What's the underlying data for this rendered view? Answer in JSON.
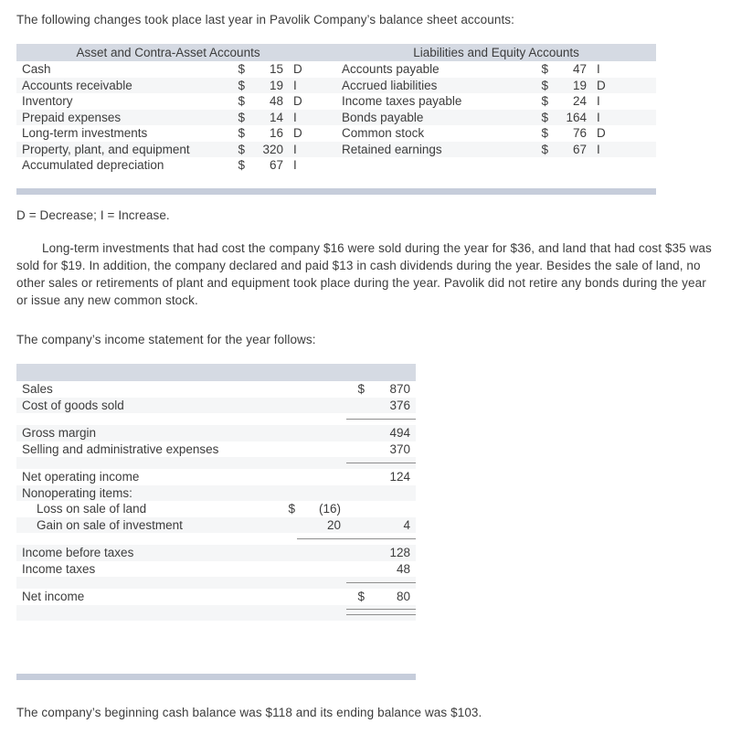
{
  "intro_text": "The following changes took place last year in Pavolik Company’s balance sheet accounts:",
  "legend_text": "D = Decrease; I = Increase.",
  "story_text": "Long-term investments that had cost the company $16 were sold during the year for $36, and land that had cost $35 was sold for $19. In addition, the company declared and paid $13 in cash dividends during the year. Besides the sale of land, no other sales or retirements of plant and equipment took place during the year. Pavolik did not retire any bonds during the year or issue any new common stock.",
  "income_intro_text": "The company’s income statement for the year follows:",
  "closing_text": "The company’s beginning cash balance was $118 and its ending balance was $103.",
  "balance_sheet": {
    "left_header": "Asset and Contra-Asset Accounts",
    "right_header": "Liabilities and Equity Accounts",
    "left_rows": [
      {
        "label": "Cash",
        "currency": "$",
        "amount": "15",
        "change": "D"
      },
      {
        "label": "Accounts receivable",
        "currency": "$",
        "amount": "19",
        "change": "I"
      },
      {
        "label": "Inventory",
        "currency": "$",
        "amount": "48",
        "change": "D"
      },
      {
        "label": "Prepaid expenses",
        "currency": "$",
        "amount": "14",
        "change": "I"
      },
      {
        "label": "Long-term investments",
        "currency": "$",
        "amount": "16",
        "change": "D"
      },
      {
        "label": "Property, plant, and equipment",
        "currency": "$",
        "amount": "320",
        "change": "I"
      },
      {
        "label": "Accumulated depreciation",
        "currency": "$",
        "amount": "67",
        "change": "I"
      }
    ],
    "right_rows": [
      {
        "label": "Accounts payable",
        "currency": "$",
        "amount": "47",
        "change": "I"
      },
      {
        "label": "Accrued liabilities",
        "currency": "$",
        "amount": "19",
        "change": "D"
      },
      {
        "label": "Income taxes payable",
        "currency": "$",
        "amount": "24",
        "change": "I"
      },
      {
        "label": "Bonds payable",
        "currency": "$",
        "amount": "164",
        "change": "I"
      },
      {
        "label": "Common stock",
        "currency": "$",
        "amount": "76",
        "change": "D"
      },
      {
        "label": "Retained earnings",
        "currency": "$",
        "amount": "67",
        "change": "I"
      },
      {
        "label": "",
        "currency": "",
        "amount": "",
        "change": ""
      }
    ]
  },
  "income_statement": {
    "header": "",
    "rows": {
      "sales": {
        "label": "Sales",
        "d1": "",
        "n1": "",
        "d2": "$",
        "n2": "870"
      },
      "cogs": {
        "label": "Cost of goods sold",
        "d1": "",
        "n1": "",
        "d2": "",
        "n2": "376"
      },
      "gross_margin": {
        "label": "Gross margin",
        "d1": "",
        "n1": "",
        "d2": "",
        "n2": "494"
      },
      "sga": {
        "label": "Selling and administrative expenses",
        "d1": "",
        "n1": "",
        "d2": "",
        "n2": "370"
      },
      "net_operating": {
        "label": "Net operating income",
        "d1": "",
        "n1": "",
        "d2": "",
        "n2": "124"
      },
      "nonoperating_hdr": {
        "label": "Nonoperating items:",
        "d1": "",
        "n1": "",
        "d2": "",
        "n2": ""
      },
      "loss_land": {
        "label": "Loss on sale of land",
        "d1": "$",
        "n1": "(16)",
        "d2": "",
        "n2": ""
      },
      "gain_investment": {
        "label": "Gain on sale of investment",
        "d1": "",
        "n1": "20",
        "d2": "",
        "n2": "4"
      },
      "income_before_tax": {
        "label": "Income before taxes",
        "d1": "",
        "n1": "",
        "d2": "",
        "n2": "128"
      },
      "income_taxes": {
        "label": "Income taxes",
        "d1": "",
        "n1": "",
        "d2": "",
        "n2": "48"
      },
      "net_income": {
        "label": "Net income",
        "d1": "",
        "n1": "",
        "d2": "$",
        "n2": "80"
      }
    }
  },
  "colors": {
    "header_band": "#d5dae3",
    "footer_bar": "#c6cddb",
    "row_stripe": "#f5f6f7",
    "rule": "#8e8e8e",
    "text": "#3c3c3c"
  }
}
